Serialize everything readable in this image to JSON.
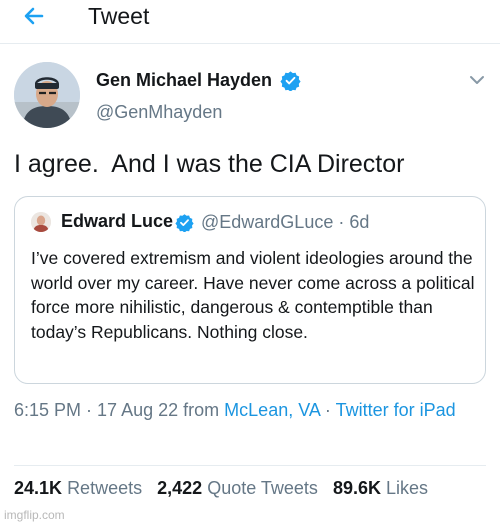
{
  "header": {
    "title": "Tweet",
    "back_icon": "arrow-left-icon",
    "accent_color": "#1da1f2"
  },
  "tweet": {
    "author": {
      "name": "Gen Michael Hayden",
      "handle": "@GenMhayden",
      "verified_icon": "verified-badge-icon"
    },
    "text": "I agree.  And I was the CIA Director",
    "quoted_tweet": {
      "author_name": "Edward Luce",
      "handle": "@EdwardGLuce",
      "separator": " · ",
      "age": "6d",
      "text": "I’ve covered extremism and violent ideologies around the world over my career. Have never come across a political force more nihilistic, dangerous & contemptible than today’s Republicans. Nothing close."
    },
    "meta": {
      "time": "6:15 PM",
      "date": "17 Aug 22",
      "from_label": "from",
      "location": "McLean, VA",
      "client": "Twitter for iPad",
      "separator": " · "
    },
    "stats": {
      "retweets_count": "24.1K",
      "retweets_label": "Retweets",
      "quote_tweets_count": "2,422",
      "quote_tweets_label": "Quote Tweets",
      "likes_count": "89.6K",
      "likes_label": "Likes"
    }
  },
  "watermark": "imgflip.com",
  "colors": {
    "link": "#1b95e0",
    "secondary_text": "#657786",
    "border": "#ccd6dd"
  }
}
